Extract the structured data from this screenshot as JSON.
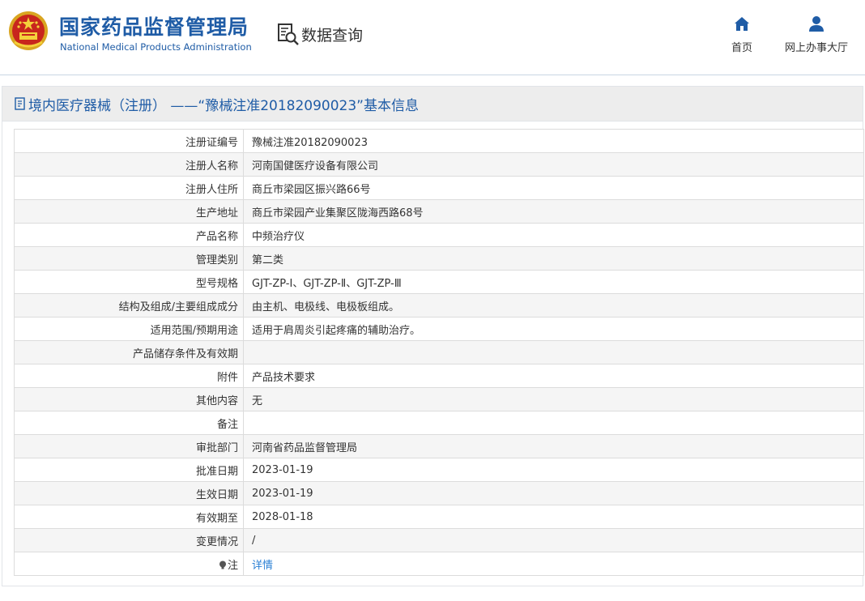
{
  "header": {
    "brand_cn": "国家药品监督管理局",
    "brand_en": "National Medical Products Administration",
    "query_label": "数据查询",
    "nav": [
      {
        "label": "首页",
        "icon": "home-icon"
      },
      {
        "label": "网上办事大厅",
        "icon": "user-icon"
      }
    ]
  },
  "panel": {
    "title": "境内医疗器械（注册） ——“豫械注准20182090023”基本信息",
    "icon": "document-icon"
  },
  "rows": [
    {
      "key": "注册证编号",
      "value": "豫械注准20182090023"
    },
    {
      "key": "注册人名称",
      "value": "河南国健医疗设备有限公司"
    },
    {
      "key": "注册人住所",
      "value": "商丘市梁园区振兴路66号"
    },
    {
      "key": "生产地址",
      "value": "商丘市梁园产业集聚区陇海西路68号"
    },
    {
      "key": "产品名称",
      "value": "中频治疗仪"
    },
    {
      "key": "管理类别",
      "value": "第二类"
    },
    {
      "key": "型号规格",
      "value": "GJT-ZP-Ⅰ、GJT-ZP-Ⅱ、GJT-ZP-Ⅲ"
    },
    {
      "key": "结构及组成/主要组成成分",
      "value": "由主机、电极线、电极板组成。"
    },
    {
      "key": "适用范围/预期用途",
      "value": "适用于肩周炎引起疼痛的辅助治疗。"
    },
    {
      "key": "产品储存条件及有效期",
      "value": ""
    },
    {
      "key": "附件",
      "value": "产品技术要求"
    },
    {
      "key": "其他内容",
      "value": "无"
    },
    {
      "key": "备注",
      "value": ""
    },
    {
      "key": "审批部门",
      "value": "河南省药品监督管理局"
    },
    {
      "key": "批准日期",
      "value": "2023-01-19"
    },
    {
      "key": "生效日期",
      "value": "2023-01-19"
    },
    {
      "key": "有效期至",
      "value": "2028-01-18"
    },
    {
      "key": "变更情况",
      "value": "/"
    },
    {
      "key": "注",
      "value": "详情"
    }
  ],
  "colors": {
    "brand": "#1f5ca6",
    "link": "#2a7fd4",
    "panel_head": "#ededed",
    "stripe": "#f5f5f5"
  }
}
